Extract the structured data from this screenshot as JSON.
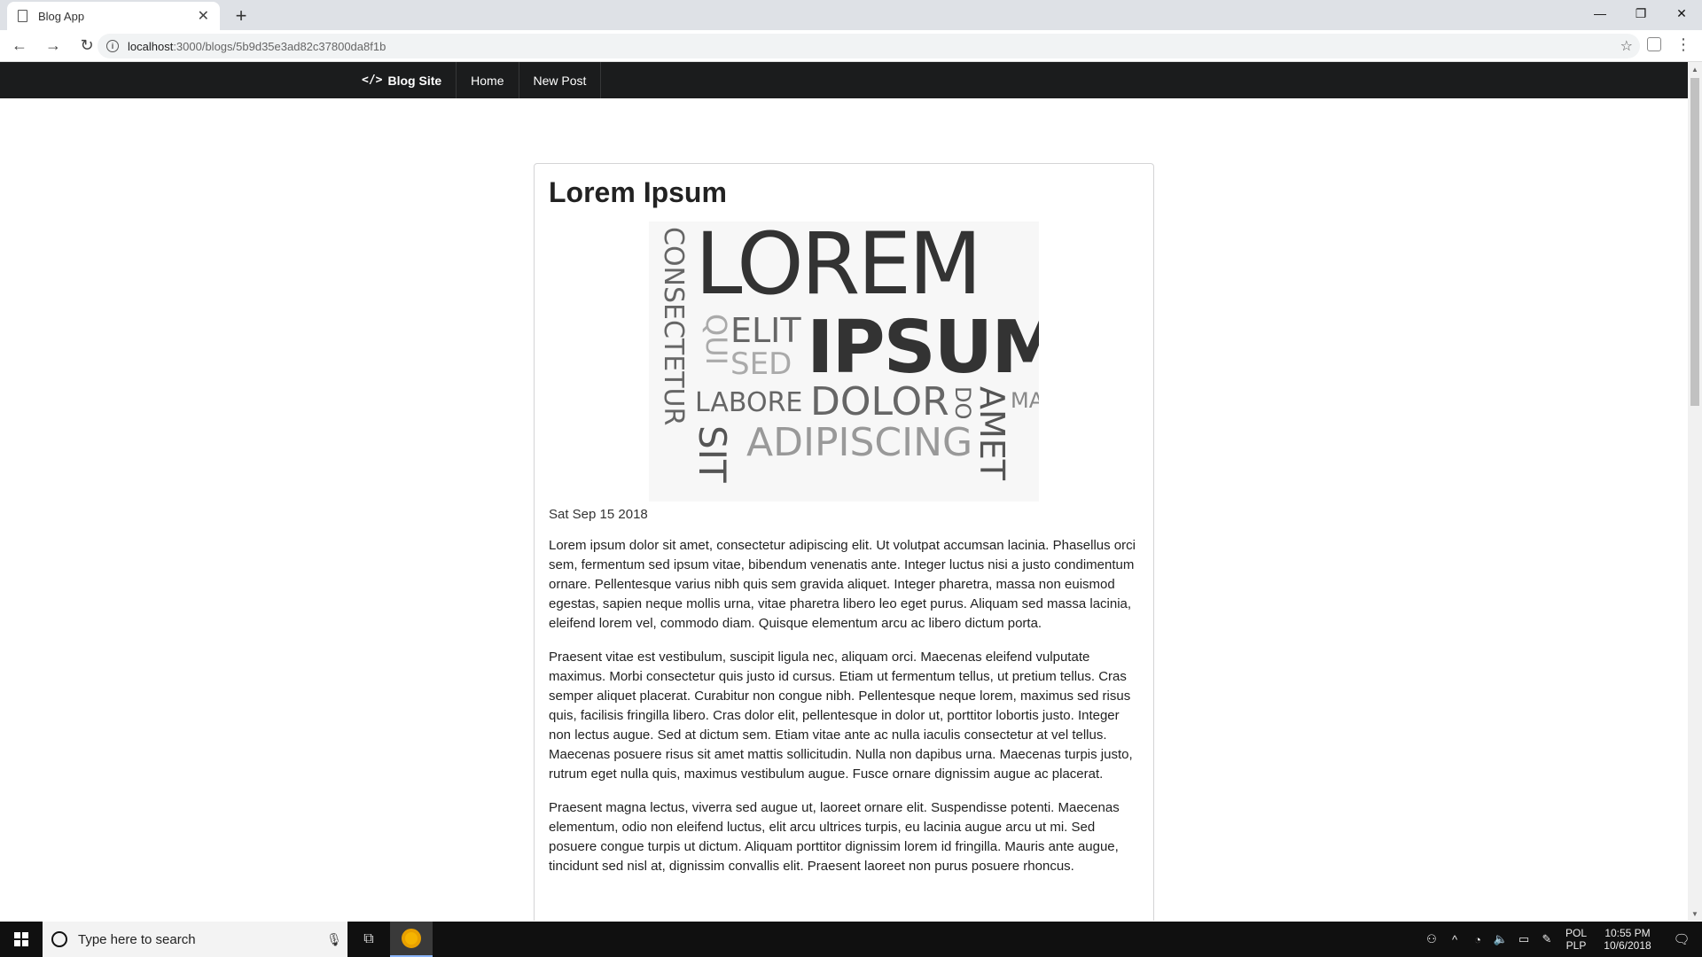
{
  "browser": {
    "tab_title": "Blog App",
    "tab_close": "✕",
    "new_tab": "+",
    "url_host": "localhost",
    "url_path": ":3000/blogs/5b9d35e3ad82c37800da8f1b",
    "win_minimize": "—",
    "win_restore": "❐",
    "win_close": "✕",
    "back": "←",
    "forward": "→",
    "reload": "↻",
    "star": "☆",
    "menu": "⋮"
  },
  "site_nav": {
    "brand_icon": "</>",
    "brand": "Blog Site",
    "items": [
      "Home",
      "New Post"
    ]
  },
  "post": {
    "title": "Lorem Ipsum",
    "date": "Sat Sep 15 2018",
    "paragraphs": [
      "Lorem ipsum dolor sit amet, consectetur adipiscing elit. Ut volutpat accumsan lacinia. Phasellus orci sem, fermentum sed ipsum vitae, bibendum venenatis ante. Integer luctus nisi a justo condimentum ornare. Pellentesque varius nibh quis sem gravida aliquet. Integer pharetra, massa non euismod egestas, sapien neque mollis urna, vitae pharetra libero leo eget purus. Aliquam sed massa lacinia, eleifend lorem vel, commodo diam. Quisque elementum arcu ac libero dictum porta.",
      "Praesent vitae est vestibulum, suscipit ligula nec, aliquam orci. Maecenas eleifend vulputate maximus. Morbi consectetur quis justo id cursus. Etiam ut fermentum tellus, ut pretium tellus. Cras semper aliquet placerat. Curabitur non congue nibh. Pellentesque neque lorem, maximus sed risus quis, facilisis fringilla libero. Cras dolor elit, pellentesque in dolor ut, porttitor lobortis justo. Integer non lectus augue. Sed at dictum sem. Etiam vitae ante ac nulla iaculis consectetur at vel tellus. Maecenas posuere risus sit amet mattis sollicitudin. Nulla non dapibus urna. Maecenas turpis justo, rutrum eget nulla quis, maximus vestibulum augue. Fusce ornare dignissim augue ac placerat.",
      "Praesent magna lectus, viverra sed augue ut, laoreet ornare elit. Suspendisse potenti. Maecenas elementum, odio non eleifend luctus, elit arcu ultrices turpis, eu lacinia augue arcu ut mi. Sed posuere congue turpis ut dictum. Aliquam porttitor dignissim lorem id fringilla. Mauris ante augue, tincidunt sed nisl at, dignissim convallis elit. Praesent laoreet non purus posuere rhoncus."
    ],
    "image_words": {
      "lorem": "LOREM",
      "ipsum": "IPSUM",
      "consectetur": "CONSECTETUR",
      "qui": "QUI",
      "elit": "ELIT",
      "sed": "SED",
      "labore": "LABORE",
      "dolor": "DOLOR",
      "do": "DO",
      "amet": "AMET",
      "ma": "MA",
      "sit": "SIT",
      "adipiscing": "ADIPISCING"
    }
  },
  "taskbar": {
    "search_placeholder": "Type here to search",
    "lang_top": "POL",
    "lang_bottom": "PLP",
    "time": "10:55 PM",
    "date": "10/6/2018"
  }
}
